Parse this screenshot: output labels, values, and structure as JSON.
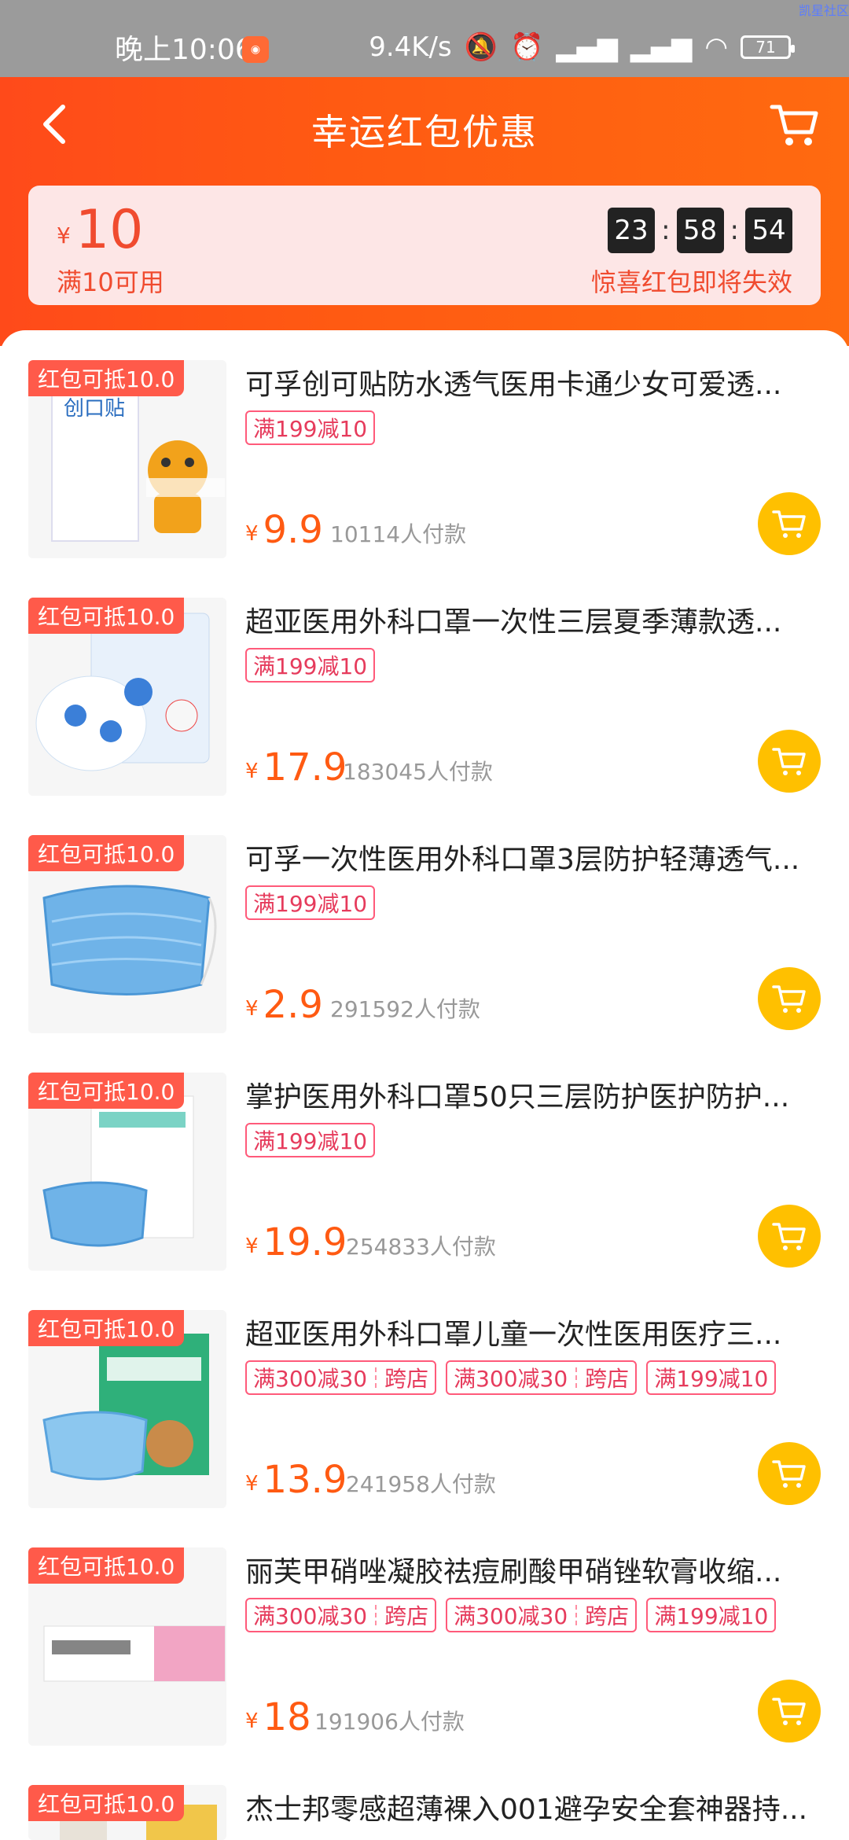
{
  "status_bar": {
    "time": "晚上10:06",
    "network_speed": "9.4K/s",
    "battery": "71",
    "watermark": "凯星社区"
  },
  "header": {
    "title": "幸运红包优惠"
  },
  "coupon": {
    "currency": "¥",
    "amount": "10",
    "condition": "满10可用",
    "timer": {
      "h": "23",
      "m": "58",
      "s": "54"
    },
    "warning": "惊喜红包即将失效"
  },
  "products": [
    {
      "badge": "红包可抵10.0",
      "title": "可孚创可贴防水透气医用卡通少女可爱透...",
      "tags": [
        {
          "text": "满199减10"
        }
      ],
      "currency": "¥",
      "price": "9.9",
      "sold": "10114人付款"
    },
    {
      "badge": "红包可抵10.0",
      "title": "超亚医用外科口罩一次性三层夏季薄款透...",
      "tags": [
        {
          "text": "满199减10"
        }
      ],
      "currency": "¥",
      "price": "17.9",
      "sold": "183045人付款"
    },
    {
      "badge": "红包可抵10.0",
      "title": "可孚一次性医用外科口罩3层防护轻薄透气...",
      "tags": [
        {
          "text": "满199减10"
        }
      ],
      "currency": "¥",
      "price": "2.9",
      "sold": "291592人付款"
    },
    {
      "badge": "红包可抵10.0",
      "title": "掌护医用外科口罩50只三层防护医护防护...",
      "tags": [
        {
          "text": "满199减10"
        }
      ],
      "currency": "¥",
      "price": "19.9",
      "sold": "254833人付款"
    },
    {
      "badge": "红包可抵10.0",
      "title": "超亚医用外科口罩儿童一次性医用医疗三...",
      "tags": [
        {
          "text": "满300减30",
          "extra": "跨店"
        },
        {
          "text": "满300减30",
          "extra": "跨店"
        },
        {
          "text": "满199减10"
        }
      ],
      "currency": "¥",
      "price": "13.9",
      "sold": "241958人付款"
    },
    {
      "badge": "红包可抵10.0",
      "title": "丽芙甲硝唑凝胶祛痘刷酸甲硝锉软膏收缩...",
      "tags": [
        {
          "text": "满300减30",
          "extra": "跨店"
        },
        {
          "text": "满300减30",
          "extra": "跨店"
        },
        {
          "text": "满199减10"
        }
      ],
      "currency": "¥",
      "price": "18",
      "sold": "191906人付款"
    },
    {
      "badge": "红包可抵10.0",
      "title": "杰士邦零感超薄裸入001避孕安全套神器持..."
    }
  ],
  "colors": {
    "accent": "#ff5a12",
    "badge": "#ff5a4a",
    "cart_button": "#ffc000",
    "tag": "#e63b5c"
  }
}
